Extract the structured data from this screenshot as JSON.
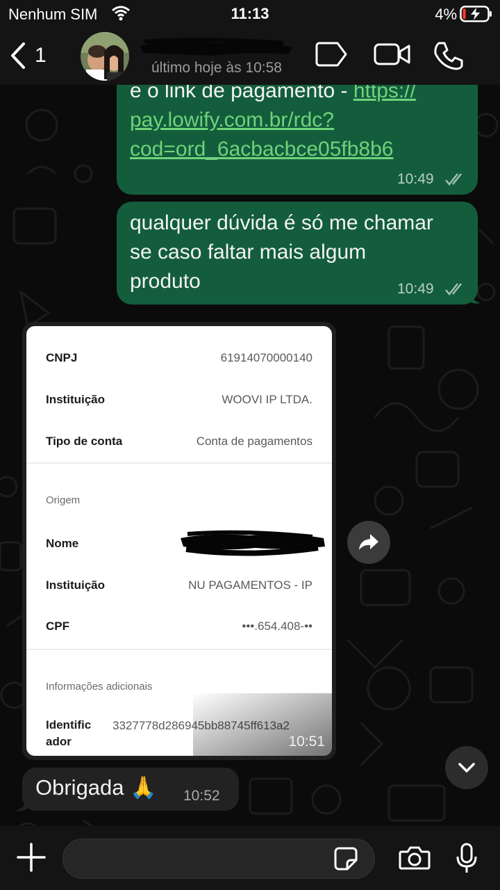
{
  "status_bar": {
    "carrier": "Nenhum SIM",
    "time": "11:13",
    "battery_percent": "4%"
  },
  "header": {
    "back_count": "1",
    "last_seen": "último hoje às 10:58",
    "icons": [
      "back-chevron-icon",
      "avatar",
      "label-tag-icon",
      "video-call-icon",
      "phone-icon"
    ]
  },
  "messages": {
    "m1": {
      "text_prefix": "e o link de pagamento - ",
      "link_part1": "https://",
      "link_part2": "pay.lowify.com.br/rdc?",
      "link_part3": "cod=ord_6acbacbce05fb8b6",
      "time": "10:49"
    },
    "m2": {
      "line1": "qualquer dúvida é só me chamar",
      "line2": "se caso faltar mais algum",
      "line3": "produto",
      "time": "10:49"
    },
    "image": {
      "time": "10:51",
      "receipt": {
        "rows_top": [
          {
            "label": "CNPJ",
            "value": "61914070000140"
          },
          {
            "label": "Instituição",
            "value": "WOOVI IP LTDA."
          },
          {
            "label": "Tipo de conta",
            "value": "Conta de pagamentos"
          }
        ],
        "origem_title": "Origem",
        "rows_origem": [
          {
            "label": "Nome",
            "value": ""
          },
          {
            "label": "Instituição",
            "value": "NU PAGAMENTOS - IP"
          },
          {
            "label": "CPF",
            "value": "•••.654.408-••"
          }
        ],
        "info_title": "Informações adicionais",
        "identificador_label_1": "Identific",
        "identificador_label_2": "ador",
        "identificador_value": "3327778d286945bb88745ff613a2"
      }
    },
    "m3": {
      "text": "Obrigada 🙏",
      "time": "10:52"
    }
  },
  "colors": {
    "outgoing_bubble": "#135d3d",
    "incoming_bubble": "#222222",
    "link": "#6fd37a",
    "background": "#0b0b0b"
  }
}
